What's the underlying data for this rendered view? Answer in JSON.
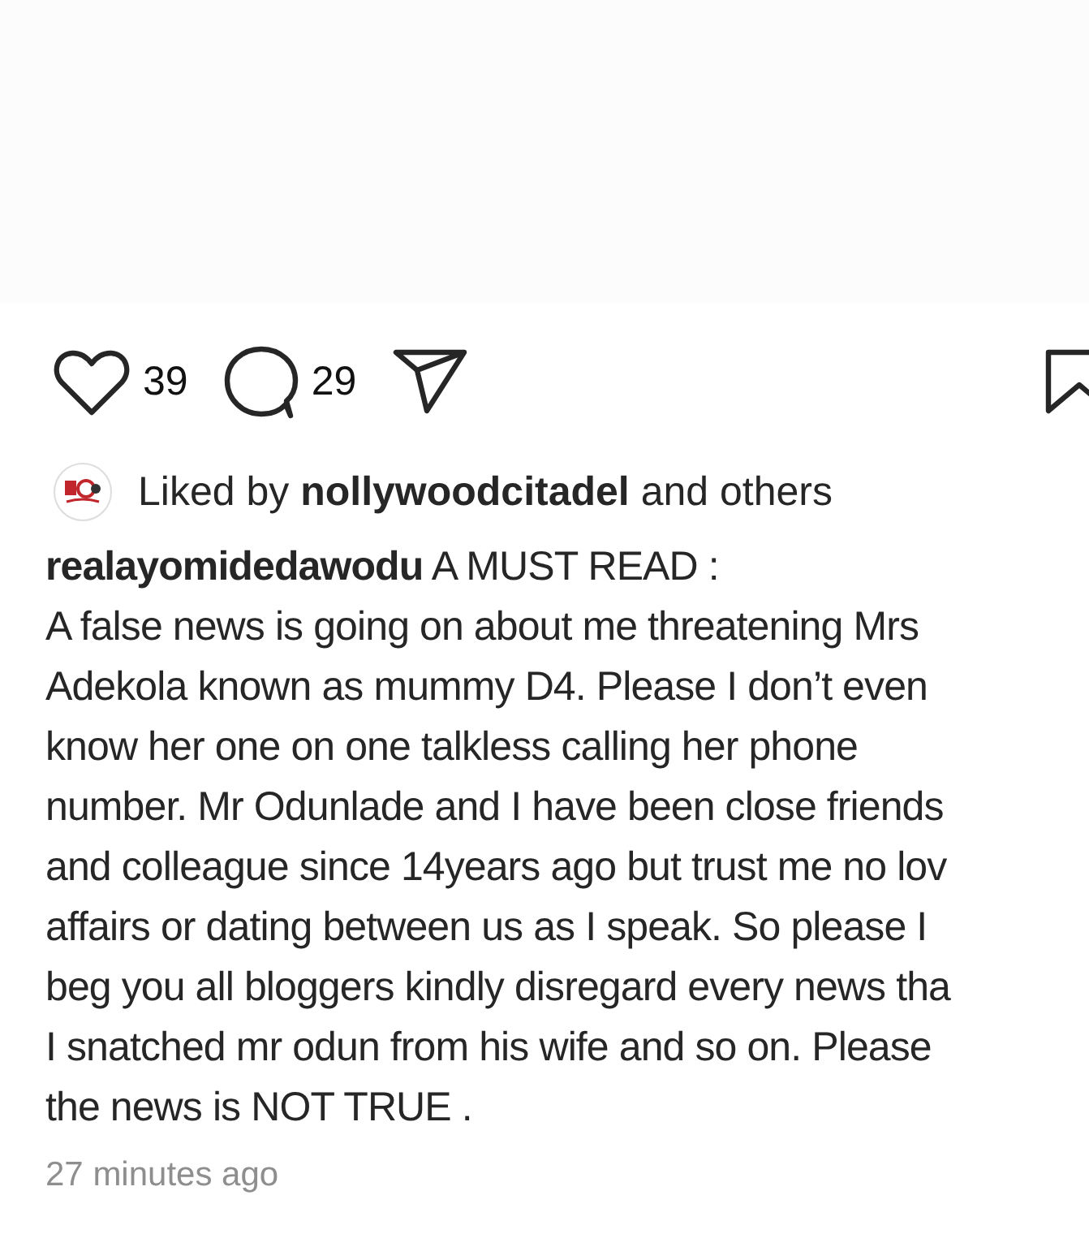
{
  "actions": {
    "likes": "39",
    "comments": "29"
  },
  "liked_by": {
    "prefix": "Liked by",
    "user": "nollywoodcitadel",
    "suffix": "and others"
  },
  "caption_lines": [
    "**realayomidedawodu** A MUST READ :",
    "A false news is going on about me threatening Mrs",
    "Adekola known as mummy D4. Please I don’t even",
    "know her one on one talkless calling her phone",
    "number. Mr Odunlade and I have been close friends",
    "and colleague since 14years ago but trust me no lov",
    "affairs or dating between us as I speak. So please I",
    "beg you all bloggers kindly disregard every news tha",
    "I snatched mr odun from his wife and so on. Please",
    "the news is NOT TRUE ."
  ],
  "timestamp": "27 minutes ago"
}
